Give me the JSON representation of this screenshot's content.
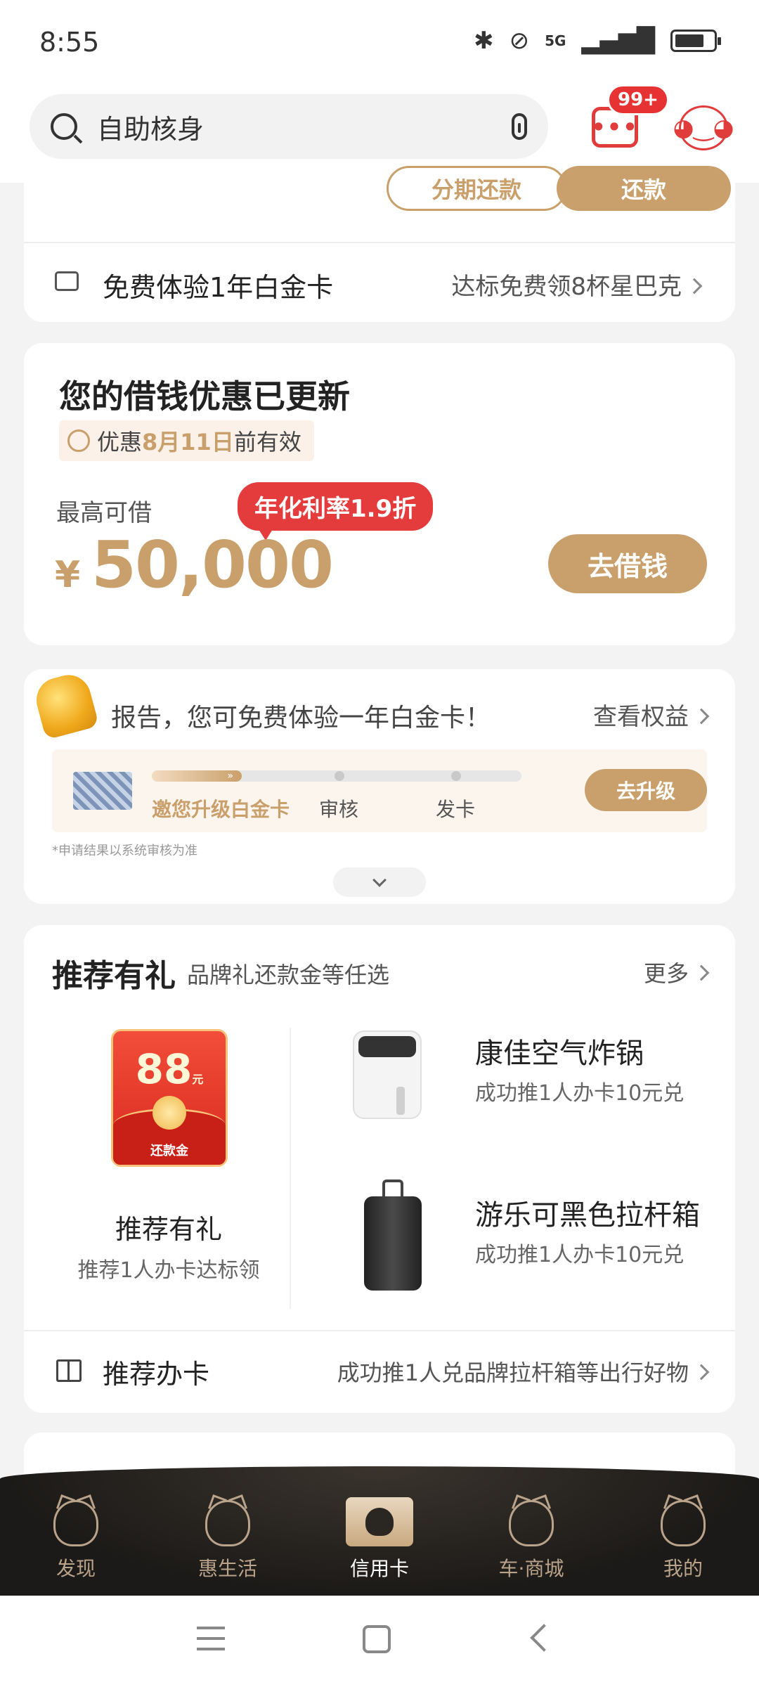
{
  "status_bar": {
    "time": "8:55",
    "network": "5G"
  },
  "header": {
    "search_text": "自助核身",
    "badge": "99+",
    "msg_dots": "•••"
  },
  "repay_card": {
    "installment_label": "分期还款",
    "repay_label": "还款",
    "platinum_label": "免费体验1年白金卡",
    "platinum_right": "达标免费领8杯星巴克"
  },
  "loan_card": {
    "title": "您的借钱优惠已更新",
    "promo_prefix": "优惠",
    "promo_date": "8月11日",
    "promo_suffix": "前有效",
    "max_label": "最高可借",
    "rate_tag": "年化利率1.9折",
    "currency": "¥",
    "amount": "50,000",
    "button": "去借钱"
  },
  "upgrade_card": {
    "report_text": "报告，您可免费体验一年白金卡！",
    "view_rights": "查看权益",
    "progress_arrows": "»",
    "steps": [
      "邀您升级白金卡",
      "审核",
      "发卡"
    ],
    "button": "去升级",
    "disclaimer": "*申请结果以系统审核为准"
  },
  "recommend": {
    "title": "推荐有礼",
    "subtitle": "品牌礼还款金等任选",
    "more": "更多",
    "redpacket_amount": "88",
    "redpacket_unit": "元",
    "redpacket_label": "还款金",
    "left_title": "推荐有礼",
    "left_sub": "推荐1人办卡达标领",
    "products": [
      {
        "title": "康佳空气炸锅",
        "sub": "成功推1人办卡10元兑"
      },
      {
        "title": "游乐可黑色拉杆箱",
        "sub": "成功推1人办卡10元兑"
      }
    ],
    "card_label": "推荐办卡",
    "card_right": "成功推1人兑品牌拉杆箱等出行好物"
  },
  "bottom_nav": [
    {
      "label": "发现",
      "icon": "discover-cat-icon"
    },
    {
      "label": "惠生活",
      "icon": "life-cat-icon"
    },
    {
      "label": "信用卡",
      "icon": "credit-card-cat-icon"
    },
    {
      "label": "车·商城",
      "icon": "car-mall-cat-icon"
    },
    {
      "label": "我的",
      "icon": "profile-cat-icon"
    }
  ],
  "colors": {
    "accent": "#c9a06c",
    "red": "#e43c3c",
    "nav_bg": "#1c1a18"
  }
}
